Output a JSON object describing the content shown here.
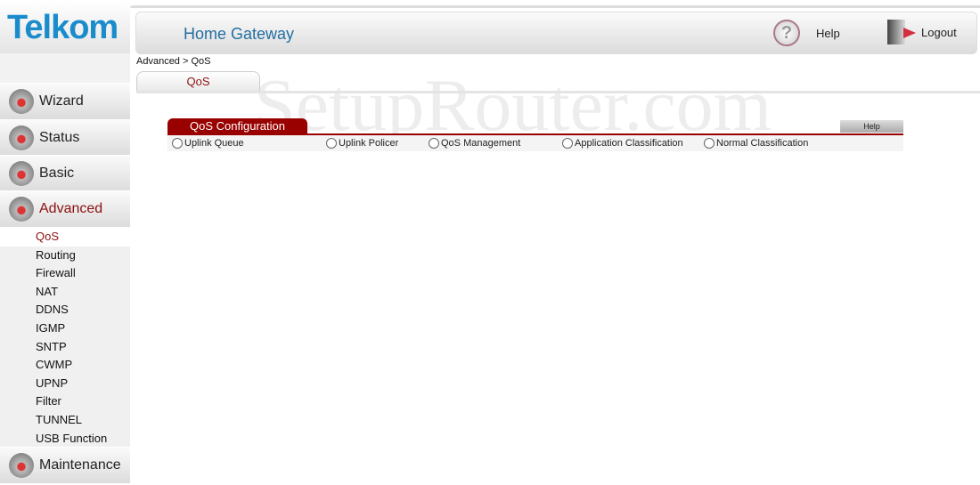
{
  "logo": "Telkom",
  "header": {
    "title": "Home Gateway",
    "help": "Help",
    "logout": "Logout"
  },
  "breadcrumb": "Advanced > QoS",
  "tab": "QoS",
  "watermark": "SetupRouter.com",
  "nav": [
    {
      "label": "Wizard",
      "icon": "wizard-icon"
    },
    {
      "label": "Status",
      "icon": "gear-icon"
    },
    {
      "label": "Basic",
      "icon": "tools-icon"
    },
    {
      "label": "Advanced",
      "icon": "advanced-icon"
    }
  ],
  "submenu": [
    "QoS",
    "Routing",
    "Firewall",
    "NAT",
    "DDNS",
    "IGMP",
    "SNTP",
    "CWMP",
    "UPNP",
    "Filter",
    "TUNNEL",
    "USB Function"
  ],
  "maintenance": "Maintenance",
  "panel": {
    "title": "QoS Configuration",
    "help": "Help",
    "options": [
      "Uplink Queue",
      "Uplink Policer",
      "QoS Management",
      "Application Classification",
      "Normal Classification"
    ]
  }
}
